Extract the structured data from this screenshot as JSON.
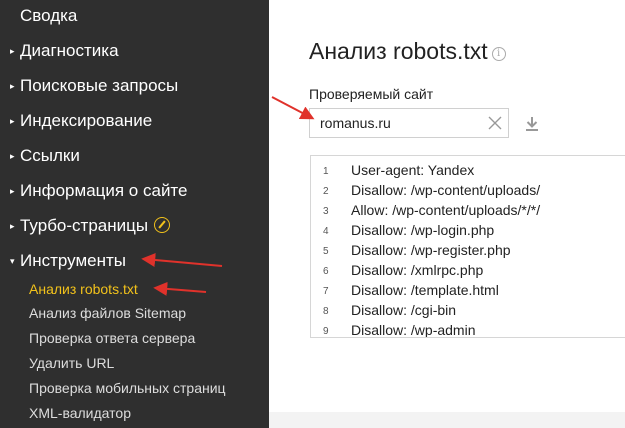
{
  "sidebar": {
    "items": [
      {
        "label": "Сводка",
        "caret": ""
      },
      {
        "label": "Диагностика",
        "caret": "▸"
      },
      {
        "label": "Поисковые запросы",
        "caret": "▸"
      },
      {
        "label": "Индексирование",
        "caret": "▸"
      },
      {
        "label": "Ссылки",
        "caret": "▸"
      },
      {
        "label": "Информация о сайте",
        "caret": "▸"
      },
      {
        "label": "Турбо-страницы",
        "caret": "▸",
        "icon": "turbo-icon"
      },
      {
        "label": "Инструменты",
        "caret": "▾",
        "expanded": true
      }
    ],
    "subitems": [
      {
        "label": "Анализ robots.txt",
        "active": true
      },
      {
        "label": "Анализ файлов Sitemap"
      },
      {
        "label": "Проверка ответа сервера"
      },
      {
        "label": "Удалить URL"
      },
      {
        "label": "Проверка мобильных страниц"
      },
      {
        "label": "XML-валидатор"
      }
    ]
  },
  "main": {
    "title": "Анализ robots.txt",
    "info_icon": "i",
    "site_label": "Проверяемый сайт",
    "site_value": "romanus.ru",
    "robots_lines": [
      {
        "n": "1",
        "text": "User-agent: Yandex"
      },
      {
        "n": "2",
        "text": "Disallow: /wp-content/uploads/"
      },
      {
        "n": "3",
        "text": "Allow: /wp-content/uploads/*/*/"
      },
      {
        "n": "4",
        "text": "Disallow: /wp-login.php"
      },
      {
        "n": "5",
        "text": "Disallow: /wp-register.php"
      },
      {
        "n": "6",
        "text": "Disallow: /xmlrpc.php"
      },
      {
        "n": "7",
        "text": "Disallow: /template.html"
      },
      {
        "n": "8",
        "text": "Disallow: /cgi-bin"
      },
      {
        "n": "9",
        "text": "Disallow: /wp-admin"
      }
    ]
  },
  "colors": {
    "sidebar_bg": "#2f2f2f",
    "active_item": "#f2c21b",
    "annotation_arrow": "#e0322b"
  }
}
